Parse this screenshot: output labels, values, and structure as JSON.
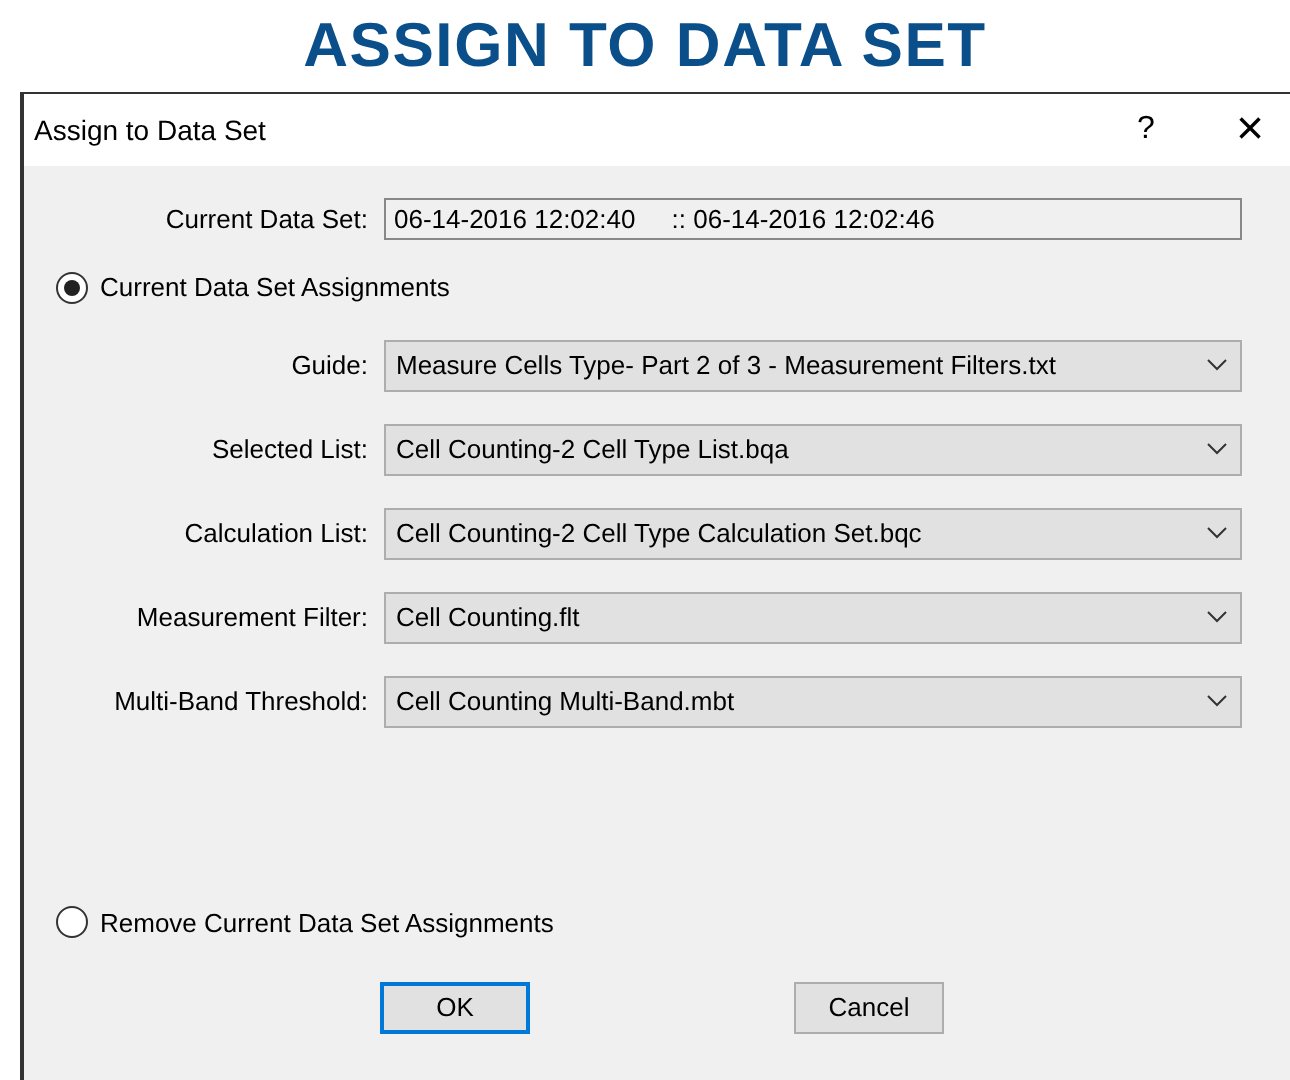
{
  "heading": "ASSIGN TO DATA SET",
  "window": {
    "title": "Assign to Data Set",
    "help": "?",
    "close": "×"
  },
  "current_data_set": {
    "label": "Current Data Set:",
    "value": "06-14-2016 12:02:40     :: 06-14-2016 12:02:46"
  },
  "options": [
    {
      "label": "Current Data Set Assignments",
      "selected": true
    },
    {
      "label": "Remove Current Data Set Assignments",
      "selected": false
    }
  ],
  "fields": [
    {
      "label": "Guide:",
      "value": "Measure Cells Type- Part 2 of 3 - Measurement Filters.txt"
    },
    {
      "label": "Selected List:",
      "value": "Cell Counting-2 Cell Type List.bqa"
    },
    {
      "label": "Calculation List:",
      "value": "Cell Counting-2 Cell Type Calculation Set.bqc"
    },
    {
      "label": "Measurement Filter:",
      "value": "Cell Counting.flt"
    },
    {
      "label": "Multi-Band Threshold:",
      "value": "Cell Counting Multi-Band.mbt"
    }
  ],
  "buttons": [
    {
      "label": "OK",
      "default": true
    },
    {
      "label": "Cancel",
      "default": false
    }
  ]
}
